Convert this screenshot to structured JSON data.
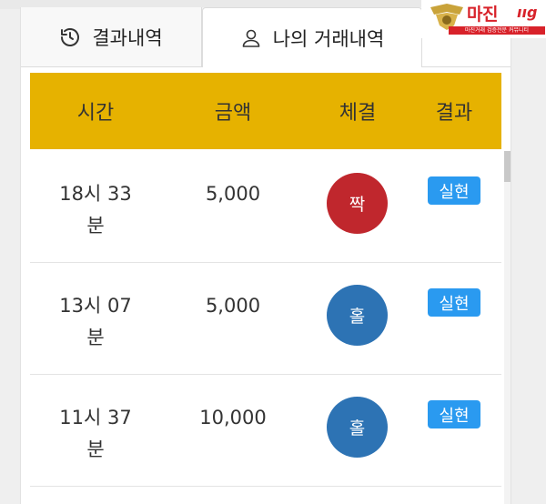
{
  "tabs": [
    {
      "label": "결과내역",
      "icon": "history-icon",
      "active": false
    },
    {
      "label": "나의 거래내역",
      "icon": "user-icon",
      "active": true
    }
  ],
  "logo": {
    "title": "마진",
    "tagline": "마진거래 검증전문 커뮤니티"
  },
  "table": {
    "headers": [
      "시간",
      "금액",
      "체결",
      "결과"
    ],
    "rows": [
      {
        "time_line1": "18시 33",
        "time_line2": "분",
        "amount": "5,000",
        "executed": "짝",
        "executed_type": "even",
        "result": "실현"
      },
      {
        "time_line1": "13시 07",
        "time_line2": "분",
        "amount": "5,000",
        "executed": "홀",
        "executed_type": "odd",
        "result": "실현"
      },
      {
        "time_line1": "11시 37",
        "time_line2": "분",
        "amount": "10,000",
        "executed": "홀",
        "executed_type": "odd",
        "result": "실현"
      }
    ]
  },
  "colors": {
    "header_bg": "#e6b200",
    "even_ball": "#c0272d",
    "odd_ball": "#2d73b4",
    "result_badge": "#2a9af0",
    "logo_red": "#d8222a"
  }
}
